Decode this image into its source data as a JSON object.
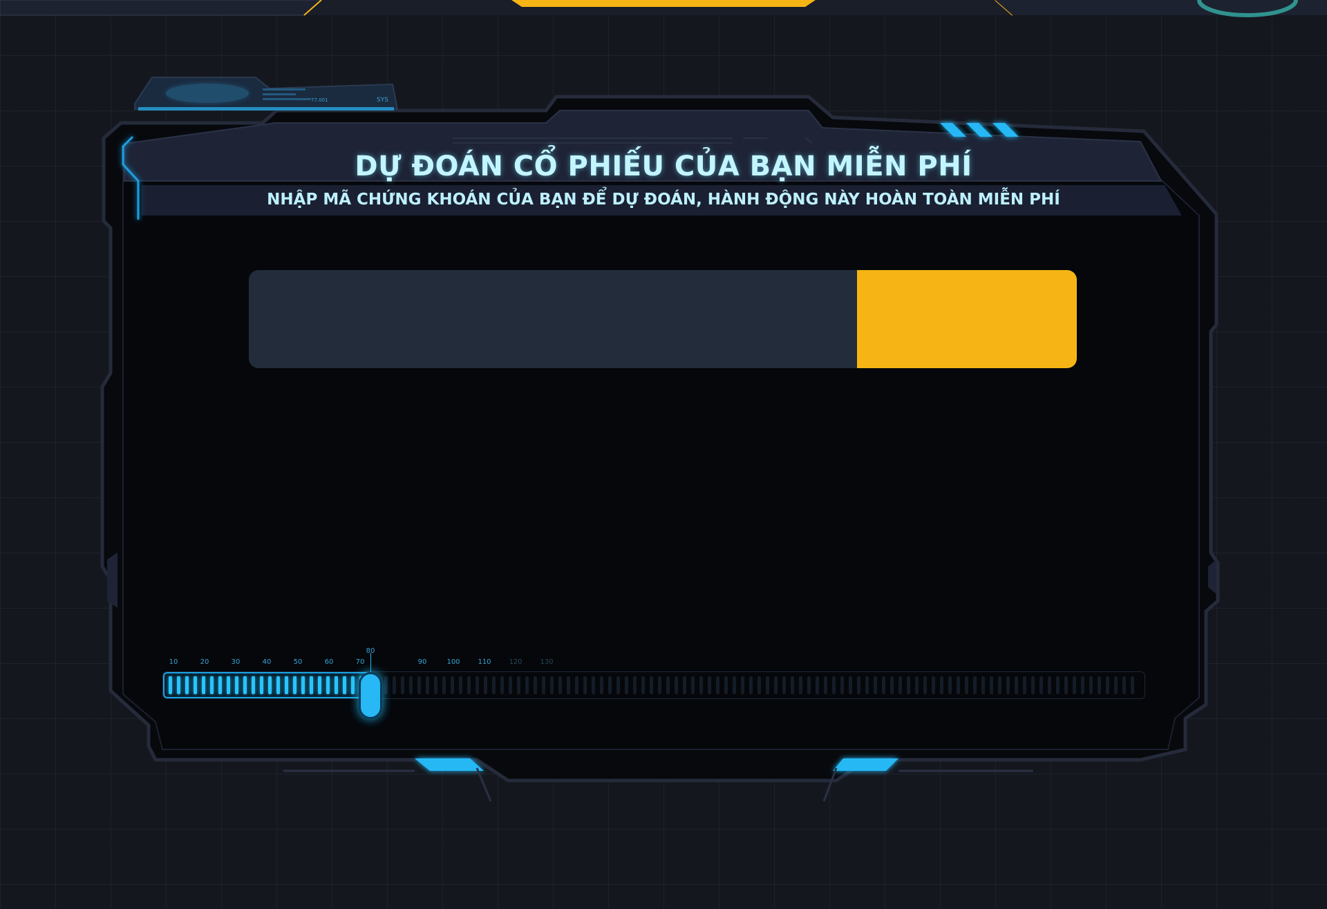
{
  "header": {
    "title": "DỰ ĐOÁN CỔ PHIẾU CỦA BẠN MIỄN PHÍ",
    "subtitle": "NHẬP MÃ CHỨNG KHOÁN CỦA BẠN ĐỂ DỰ ĐOÁN, HÀNH ĐỘNG NÀY HOÀN TOÀN MIỄN PHÍ"
  },
  "search": {
    "value": "",
    "button_label": ""
  },
  "decor": {
    "sys_label": "SYS",
    "code_label": "77.001"
  },
  "scale": {
    "ticks": [
      "10",
      "20",
      "30",
      "40",
      "50",
      "60",
      "70",
      "80",
      "90",
      "100",
      "110",
      "120",
      "130"
    ],
    "current_value": "80",
    "level_fraction": 0.2
  },
  "colors": {
    "accent": "#f6b514",
    "glow": "#27b8f5",
    "background": "#14171e",
    "panel": "#05070b",
    "input": "#232c3b",
    "title": "#c3f5ff"
  }
}
